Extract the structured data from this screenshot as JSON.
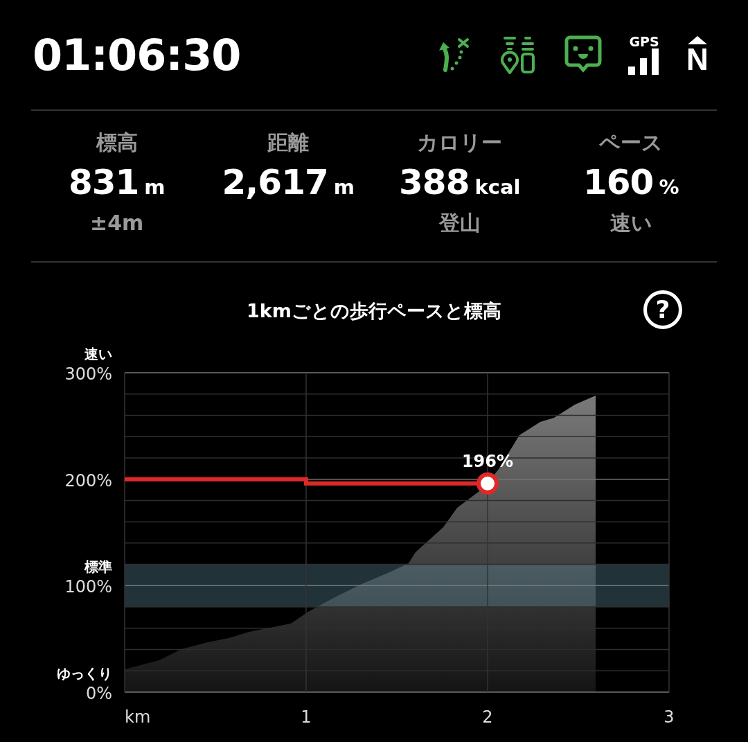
{
  "header": {
    "time": "01:06:30",
    "icons": [
      {
        "kind": "route"
      },
      {
        "kind": "locate"
      },
      {
        "kind": "chat"
      },
      {
        "kind": "gps",
        "label": "GPS"
      },
      {
        "kind": "north",
        "label": "N"
      }
    ]
  },
  "stats": [
    {
      "label": "標高",
      "value": "831",
      "unit": "m",
      "sub": "±4m"
    },
    {
      "label": "距離",
      "value": "2,617",
      "unit": "m"
    },
    {
      "label": "カロリー",
      "value": "388",
      "unit": "kcal",
      "sub": "登山"
    },
    {
      "label": "ペース",
      "value": "160",
      "unit": "%",
      "sub": "速い"
    }
  ],
  "chart": {
    "help": "?",
    "chart_data": {
      "type": "line",
      "title": "1kmごとの歩行ペースと標高",
      "x": [
        0,
        1,
        1,
        2
      ],
      "xlim": [
        0,
        3
      ],
      "ylim": [
        0,
        300
      ],
      "xticks": [
        {
          "value": 0,
          "label": "km"
        },
        {
          "value": 1,
          "label": "1"
        },
        {
          "value": 2,
          "label": "2"
        },
        {
          "value": 3,
          "label": "3"
        }
      ],
      "yticks": [
        {
          "value": 0,
          "label": "0%"
        },
        {
          "value": 100,
          "label": "100%"
        },
        {
          "value": 200,
          "label": "200%"
        },
        {
          "value": 300,
          "label": "300%"
        }
      ],
      "series": [
        {
          "color": "#e02828",
          "values": [
            200,
            200,
            196,
            196
          ]
        }
      ],
      "grid": true,
      "bands": [
        {
          "axis": "y",
          "from": 80,
          "to": 120,
          "color": "#5e8fa3",
          "label": "標準"
        }
      ],
      "annotations": [
        {
          "x": 2,
          "y": 196,
          "text": "196%"
        },
        "速い",
        "ゆっくり"
      ]
    }
  }
}
